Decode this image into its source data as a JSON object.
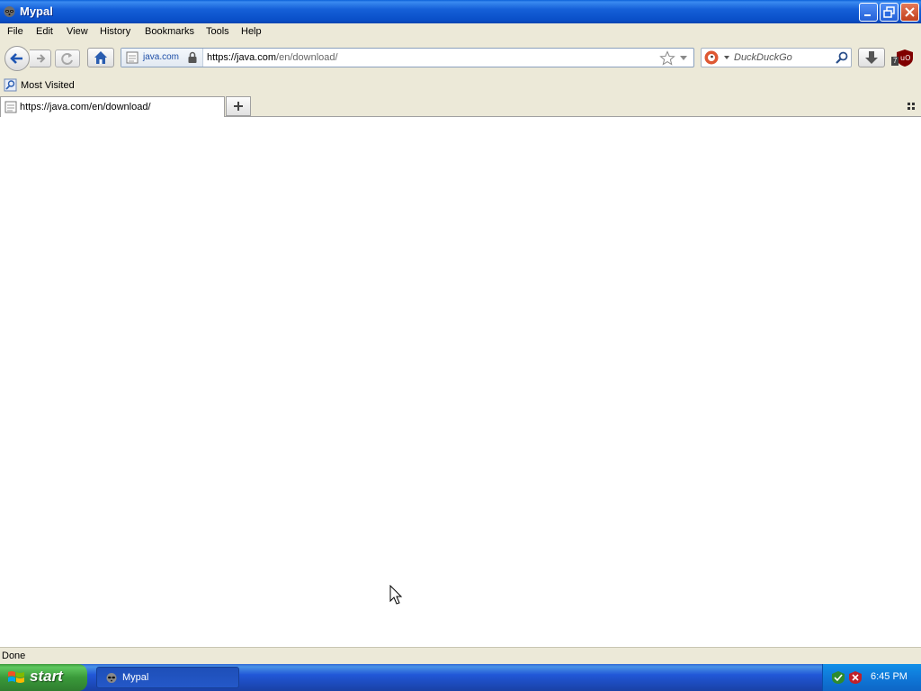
{
  "window": {
    "title": "Mypal"
  },
  "menubar": {
    "items": [
      "File",
      "Edit",
      "View",
      "History",
      "Bookmarks",
      "Tools",
      "Help"
    ]
  },
  "navbar": {
    "identity_label": "java.com",
    "url_host": "https://java.com",
    "url_path": "/en/download/",
    "search_placeholder": "DuckDuckGo",
    "ublock_count": "7"
  },
  "bookmarks": {
    "most_visited": "Most Visited"
  },
  "tabs": [
    {
      "title": "https://java.com/en/download/",
      "active": true
    }
  ],
  "status": {
    "text": "Done"
  },
  "taskbar": {
    "start_label": "start",
    "task_label": "Mypal",
    "clock": "6:45 PM"
  },
  "colors": {
    "titlebar": "#0a4fc8",
    "taskbar": "#2157d7",
    "start": "#3a9a3a"
  },
  "icons": {
    "app": "raccoon-icon",
    "back": "back-arrow-icon",
    "forward": "forward-arrow-icon",
    "reload": "reload-icon",
    "home": "home-icon",
    "lock": "lock-icon",
    "star": "star-icon",
    "search": "magnifier-icon",
    "download": "download-arrow-icon",
    "ublock": "ublock-icon"
  }
}
